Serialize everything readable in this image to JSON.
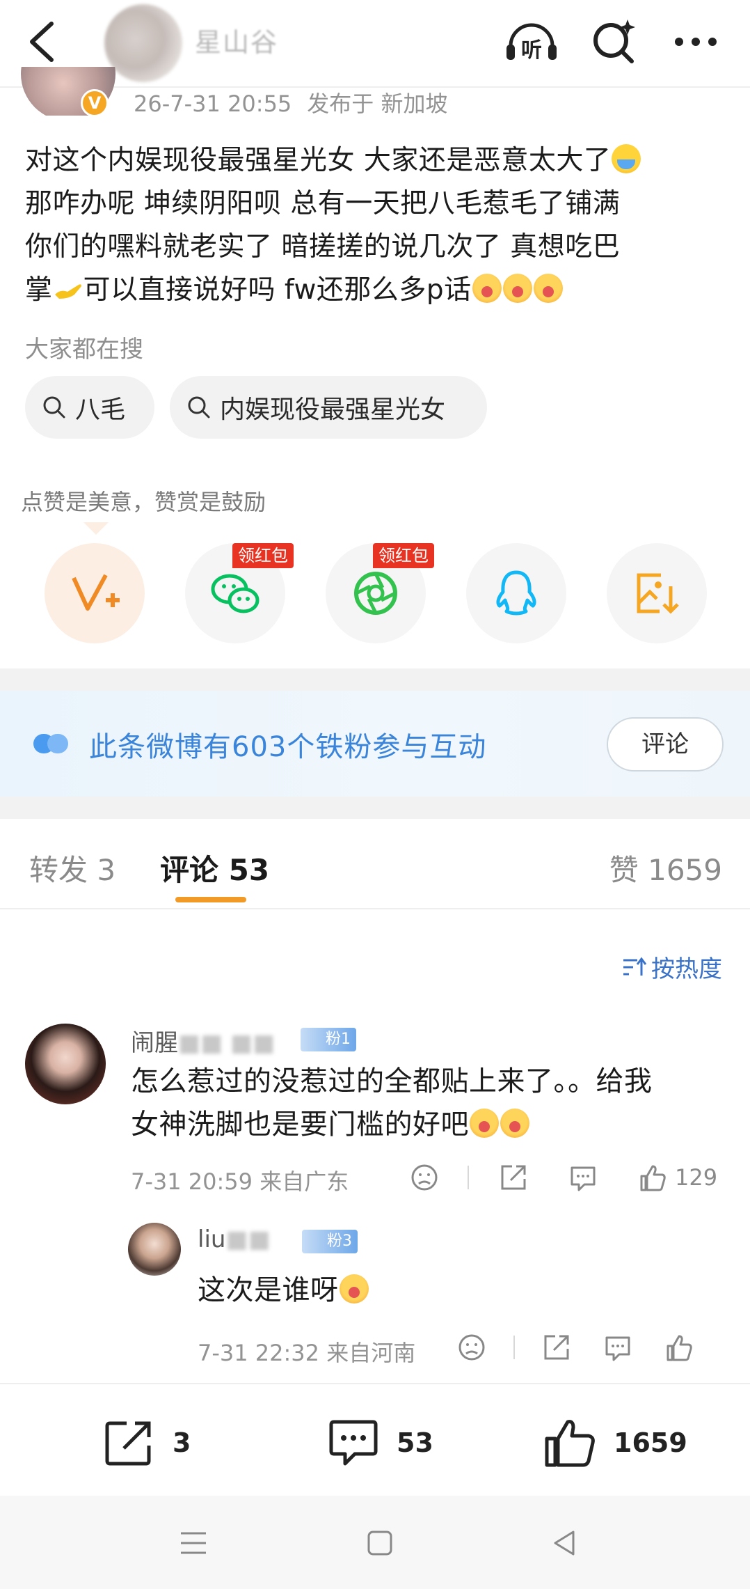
{
  "header": {
    "back_icon": "chevron-left-icon",
    "account_name": "星山谷",
    "listen_label": "听",
    "search_icon": "search-sparkle-icon",
    "more_icon": "more-horizontal-icon"
  },
  "post": {
    "verified_badge": "V",
    "date": "26-7-31 20:55",
    "location": "发布于 新加坡",
    "text_line1": "对这个内娱现役最强星光女 大家还是恶意太大了",
    "text_line2": "那咋办呢 坤续阴阳呗 总有一天把八毛惹毛了铺满",
    "text_line3": "你们的嘿料就老实了 暗搓搓的说几次了 真想吃巴",
    "text_line4_a": "掌",
    "text_line4_b": "可以直接说好吗 fw还那么多p话"
  },
  "hot_search": {
    "label": "大家都在搜",
    "chips": [
      "八毛",
      "内娱现役最强星光女"
    ]
  },
  "reward": {
    "label": "点赞是美意，赞赏是鼓励",
    "red_packet_label": "领红包",
    "share_targets": [
      "reward-v-plus-icon",
      "wechat-icon",
      "moments-icon",
      "qq-icon",
      "save-image-icon"
    ]
  },
  "fans_banner": {
    "text": "此条微博有603个铁粉参与互动",
    "button": "评论"
  },
  "tabs": {
    "repost": "转发 3",
    "comment": "评论 53",
    "like": "赞 1659"
  },
  "sort_label": "按热度",
  "comments": [
    {
      "name_visible": "闹腥",
      "badge": "粉1",
      "text_line1": "怎么惹过的没惹过的全都贴上来了。。给我",
      "text_line2": "女神洗脚也是要门槛的好吧",
      "time": "7-31 20:59",
      "location": "来自广东",
      "likes": "129"
    },
    {
      "name_visible": "liu",
      "badge": "粉3",
      "text": "这次是谁呀",
      "time": "7-31 22:32",
      "location": "来自河南",
      "likes": ""
    }
  ],
  "bottom_bar": {
    "repost_count": "3",
    "comment_count": "53",
    "like_count": "1659"
  },
  "colors": {
    "accent_orange": "#f29a27",
    "link_blue": "#3a84d9",
    "red_packet": "#e83323",
    "wechat_green": "#07c160"
  }
}
